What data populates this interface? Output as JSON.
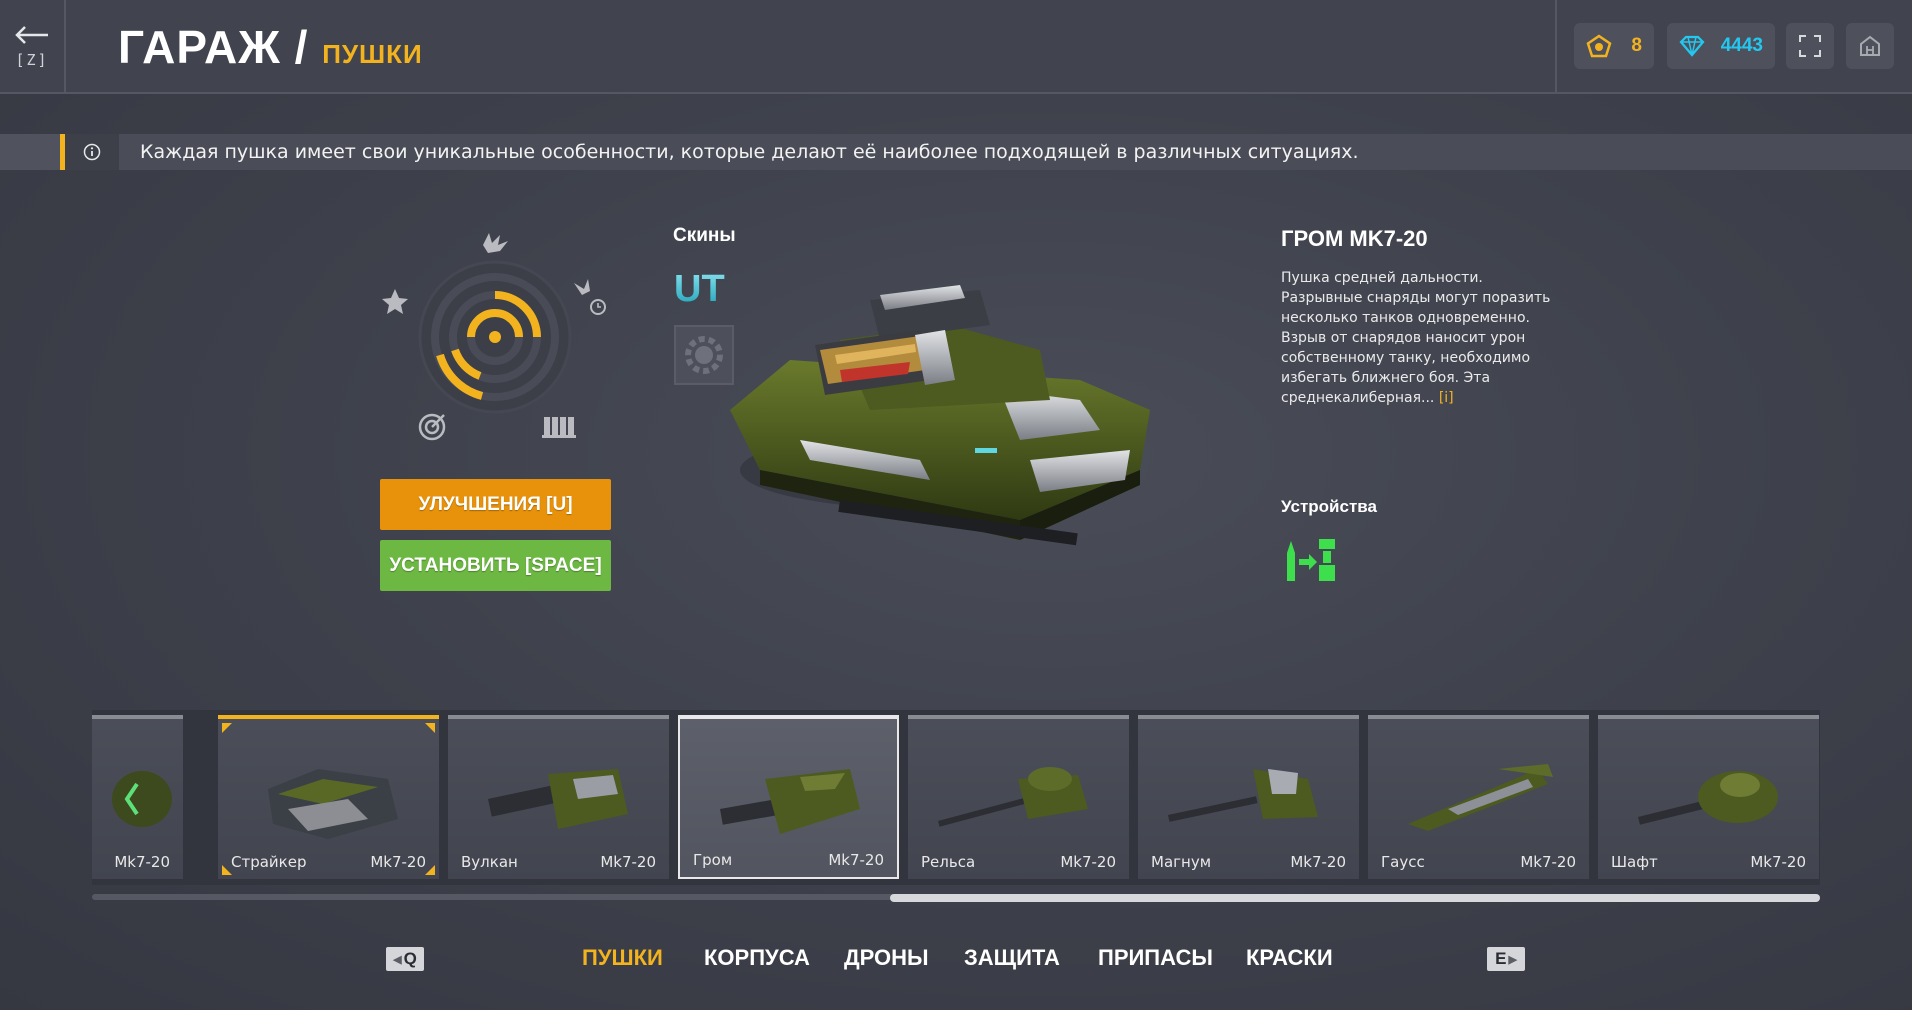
{
  "header": {
    "back_key": "[Z]",
    "title": "ГАРАЖ /",
    "subtitle": "ПУШКИ",
    "stars_value": "8",
    "gems_value": "4443",
    "accent_color": "#f3b31f",
    "gem_color": "#23c8f0"
  },
  "info": {
    "text": "Каждая пушка имеет свои уникальные особенности, которые делают её наиболее подходящей в различных ситуациях."
  },
  "actions": {
    "upgrade_label": "УЛУЧШЕНИЯ [U]",
    "install_label": "УСТАНОВИТЬ [SPACE]"
  },
  "skins": {
    "label": "Скины",
    "ut_label": "UT"
  },
  "gun": {
    "name": "ГРОМ MK7-20",
    "description": "Пушка средней дальности. Разрывные снаряды могут поразить несколько танков одновременно. Взрыв от снарядов наносит урон собственному танку, необходимо избегать ближнего боя. Эта среднекалиберная...",
    "more_label": "[i]",
    "devices_label": "Устройства"
  },
  "carousel": {
    "items": [
      {
        "name": "",
        "mk": "Mk7-20",
        "state": "partial"
      },
      {
        "name": "Страйкер",
        "mk": "Mk7-20",
        "state": "equipped"
      },
      {
        "name": "Вулкан",
        "mk": "Mk7-20",
        "state": "normal"
      },
      {
        "name": "Гром",
        "mk": "Mk7-20",
        "state": "selected"
      },
      {
        "name": "Рельса",
        "mk": "Mk7-20",
        "state": "normal"
      },
      {
        "name": "Магнум",
        "mk": "Mk7-20",
        "state": "normal"
      },
      {
        "name": "Гаусс",
        "mk": "Mk7-20",
        "state": "normal"
      },
      {
        "name": "Шафт",
        "mk": "Mk7-20",
        "state": "normal"
      }
    ]
  },
  "tabs": {
    "prev_key": "Q",
    "next_key": "E",
    "items": [
      "ПУШКИ",
      "КОРПУСА",
      "ДРОНЫ",
      "ЗАЩИТА",
      "ПРИПАСЫ",
      "КРАСКИ"
    ],
    "active": "ПУШКИ"
  }
}
